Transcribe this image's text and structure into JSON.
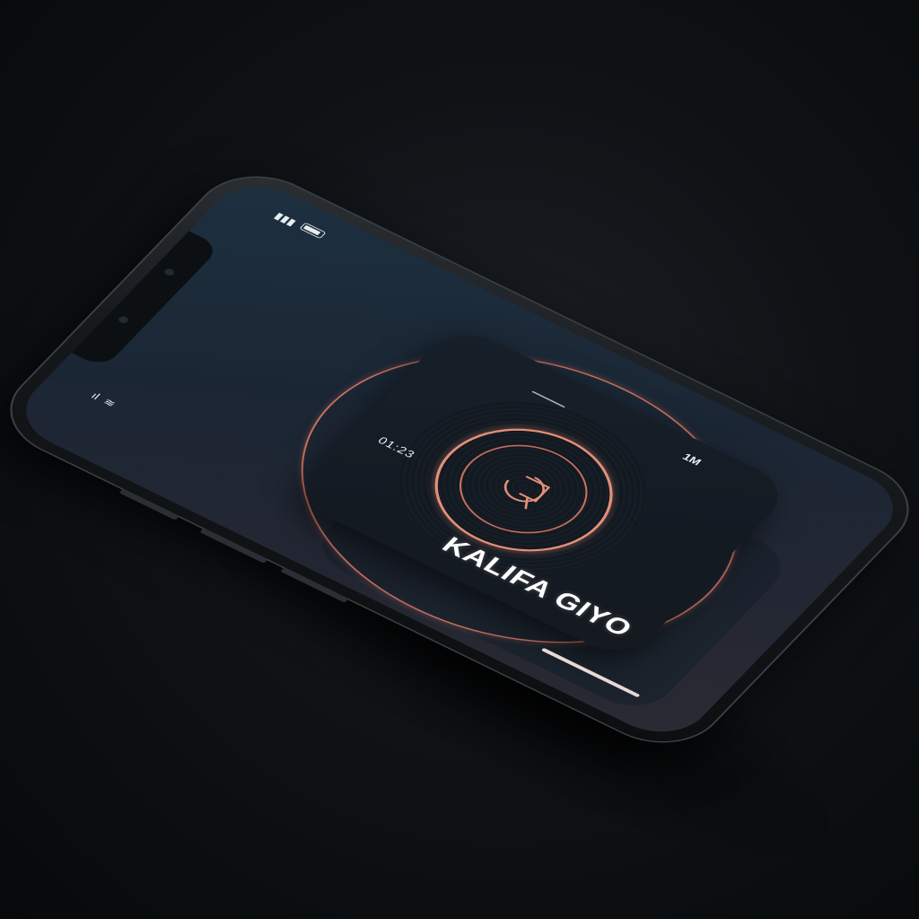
{
  "status_bar": {
    "top_signal": "▮▮▮",
    "wifi": "◠",
    "bottom_signal": "ıl",
    "bottom_wifi": "≋"
  },
  "player": {
    "elapsed_time": "01:23",
    "duration": "1M",
    "artist": "KALIFA GIYO"
  },
  "colors": {
    "accent": "#e3907a",
    "accent_dark": "#c9705f",
    "screen_bg": "#1d3140"
  }
}
